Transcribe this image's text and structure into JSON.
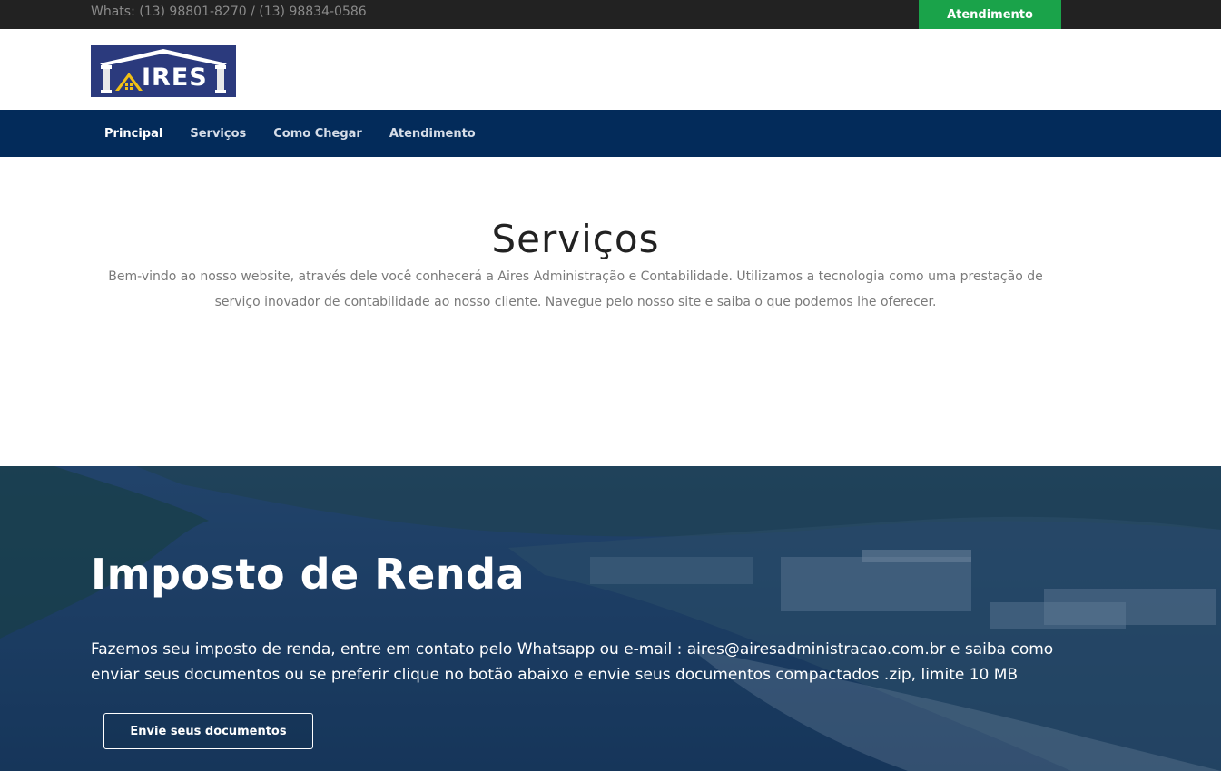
{
  "topbar": {
    "whatsapp_text": "Whats: (13) 98801-8270 / (13) 98834-0586",
    "cta_label": "Atendimento"
  },
  "logo": {
    "text": "IRES",
    "icon": "house-roof-columns-icon",
    "bg_color": "#2b3a7d",
    "accent_color": "#f2c014"
  },
  "nav": {
    "items": [
      {
        "label": "Principal",
        "active": true
      },
      {
        "label": "Serviços",
        "active": false
      },
      {
        "label": "Como Chegar",
        "active": false
      },
      {
        "label": "Atendimento",
        "active": false
      }
    ],
    "bg_color": "#032b5a"
  },
  "services": {
    "title": "Serviços",
    "description": "Bem-vindo ao nosso website, através dele você conhecerá a Aires Administração e Contabilidade. Utilizamos a tecnologia como uma prestação de serviço inovador de contabilidade ao nosso cliente. Navegue pelo nosso site e saiba o que podemos lhe oferecer."
  },
  "hero": {
    "title": "Imposto de Renda",
    "text": "Fazemos seu imposto de renda, entre em contato pelo Whatsapp ou e-mail : aires@airesadministracao.com.br e saiba como enviar seus documentos ou se preferir clique no botão abaixo e envie seus documentos compactados .zip, limite 10 MB",
    "button_label": "Envie seus documentos"
  },
  "colors": {
    "cta_green": "#1aa34a",
    "topbar_bg": "#222222"
  }
}
